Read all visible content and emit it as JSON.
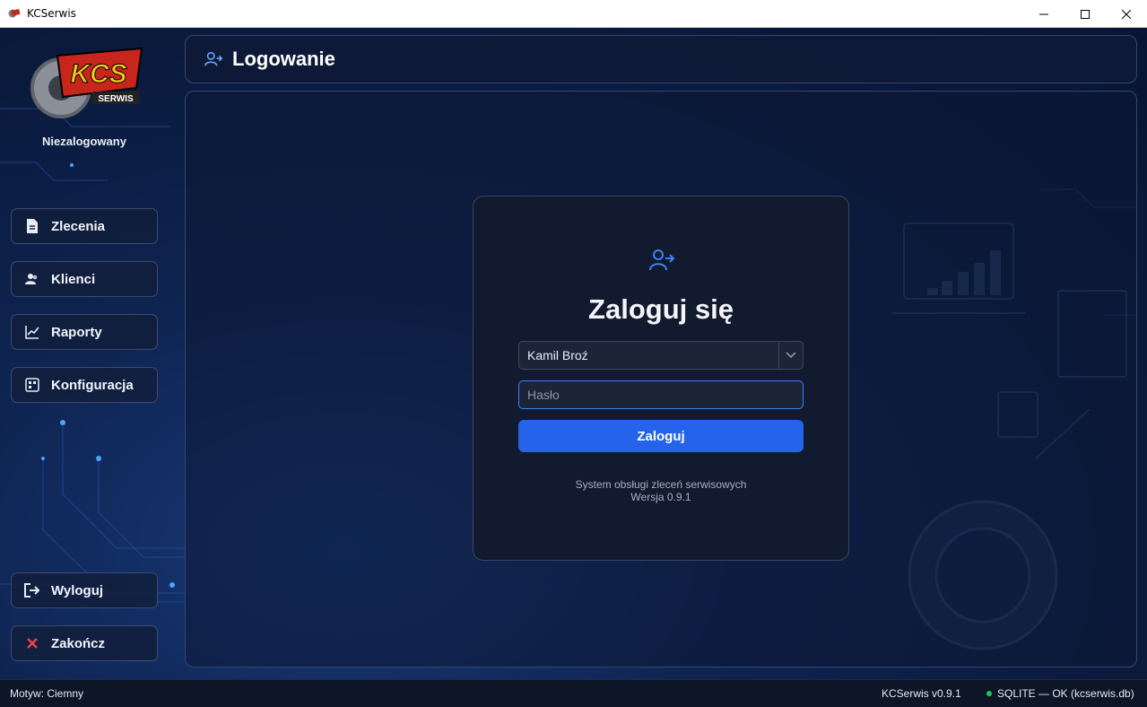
{
  "window": {
    "title": "KCSerwis"
  },
  "sidebar": {
    "logo_text": "KCS",
    "logo_sub": "SERWIS",
    "user_status": "Niezalogowany",
    "items": [
      {
        "label": "Zlecenia",
        "icon": "document-icon"
      },
      {
        "label": "Klienci",
        "icon": "users-icon"
      },
      {
        "label": "Raporty",
        "icon": "chart-icon"
      },
      {
        "label": "Konfiguracja",
        "icon": "settings-icon"
      }
    ],
    "bottom": [
      {
        "label": "Wyloguj",
        "icon": "logout-icon"
      },
      {
        "label": "Zakończ",
        "icon": "close-x-icon"
      }
    ]
  },
  "header": {
    "title": "Logowanie",
    "icon": "login-user-icon"
  },
  "login": {
    "title": "Zaloguj się",
    "user_value": "Kamil Broź",
    "password_placeholder": "Hasło",
    "button_label": "Zaloguj",
    "info_line1": "System obsługi zleceń serwisowych",
    "info_line2": "Wersja 0.9.1"
  },
  "statusbar": {
    "theme": "Motyw: Ciemny",
    "version": "KCSerwis v0.9.1",
    "db_status": "SQLITE — OK (kcserwis.db)",
    "db_status_color": "#22c55e"
  },
  "colors": {
    "accent": "#2563eb",
    "focus": "#3b82f6"
  }
}
